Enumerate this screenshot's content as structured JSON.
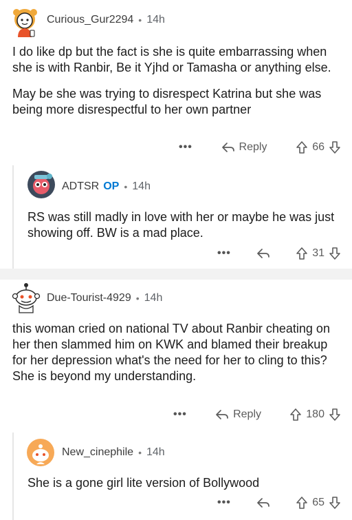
{
  "comments": [
    {
      "username": "Curious_Gur2294",
      "age": "14h",
      "paragraphs": [
        "I do like dp but the fact is she is quite embarrassing when she is with Ranbir, Be it Yjhd or Tamasha or anything else.",
        "May be she was trying to disrespect Katrina but she was  being more disrespectful to her own partner"
      ],
      "reply_label": "Reply",
      "votes": "66"
    },
    {
      "username": "ADTSR",
      "op_badge": "OP",
      "age": "14h",
      "text": "RS was still madly in love with her or maybe he was just showing off. BW is a mad place.",
      "votes": "31"
    },
    {
      "username": "Due-Tourist-4929",
      "age": "14h",
      "text": "this woman cried on national TV about Ranbir cheating on her then slammed him on KWK and blamed their breakup for her depression what's the need for her to cling to this? She is beyond my understanding.",
      "reply_label": "Reply",
      "votes": "180"
    },
    {
      "username": "New_cinephile",
      "age": "14h",
      "text": "She is a gone girl lite version of Bollywood",
      "votes": "65"
    }
  ],
  "ui": {
    "dot": "•",
    "more": "•••"
  },
  "icons": {
    "reply": "reply-arrow-icon",
    "upvote": "upvote-arrow-icon",
    "downvote": "downvote-arrow-icon"
  },
  "colors": {
    "op_badge": "#0079d3",
    "divider": "#f2f2f2",
    "thread_line": "#e6e6e6"
  }
}
